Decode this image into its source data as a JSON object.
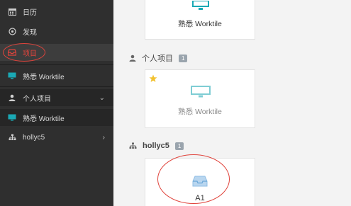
{
  "sidebar": {
    "items": [
      {
        "label": "日历",
        "icon": "calendar-icon"
      },
      {
        "label": "发现",
        "icon": "compass-icon"
      },
      {
        "label": "项目",
        "icon": "inbox-icon"
      },
      {
        "label": "熟悉 Worktile",
        "icon": "monitor-icon"
      },
      {
        "label": "个人项目",
        "icon": "user-icon",
        "chevron": "⌄"
      },
      {
        "label": "熟悉 Worktile",
        "icon": "monitor-icon"
      },
      {
        "label": "hollyc5",
        "icon": "sitemap-icon",
        "chevron": "›"
      }
    ]
  },
  "main": {
    "top_card": {
      "label": "熟悉 Worktile"
    },
    "sections": [
      {
        "title": "个人项目",
        "count": "1",
        "card": {
          "label": "熟悉 Worktile",
          "starred": true
        }
      },
      {
        "title": "hollyc5",
        "count": "1",
        "card": {
          "label": "A1"
        }
      }
    ]
  },
  "colors": {
    "sidebar_bg": "#2f2f2f",
    "accent_teal": "#1aa9b5",
    "highlight_red": "#e0443c",
    "star_yellow": "#f2c12e",
    "badge_gray": "#9aa4ad"
  }
}
